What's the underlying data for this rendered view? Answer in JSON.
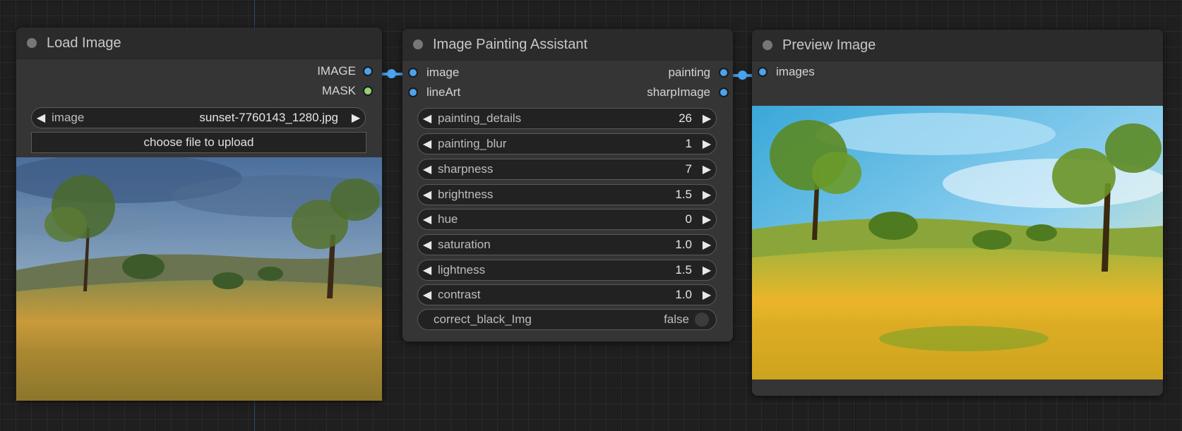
{
  "colors": {
    "accent": "#4aa3ef",
    "mask_port": "#8fd17a",
    "node_bg": "#353535"
  },
  "load_image": {
    "title": "Load Image",
    "outputs": [
      "IMAGE",
      "MASK"
    ],
    "image_widget": {
      "label": "image",
      "value": "sunset-7760143_1280.jpg"
    },
    "upload_label": "choose file to upload"
  },
  "painting": {
    "title": "Image Painting Assistant",
    "inputs": [
      "image",
      "lineArt"
    ],
    "outputs": [
      "painting",
      "sharpImage"
    ],
    "widgets": [
      {
        "label": "painting_details",
        "value": "26"
      },
      {
        "label": "painting_blur",
        "value": "1"
      },
      {
        "label": "sharpness",
        "value": "7"
      },
      {
        "label": "brightness",
        "value": "1.5"
      },
      {
        "label": "hue",
        "value": "0"
      },
      {
        "label": "saturation",
        "value": "1.0"
      },
      {
        "label": "lightness",
        "value": "1.5"
      },
      {
        "label": "contrast",
        "value": "1.0"
      }
    ],
    "toggle": {
      "label": "correct_black_Img",
      "value": "false"
    }
  },
  "preview": {
    "title": "Preview Image",
    "inputs": [
      "images"
    ]
  }
}
